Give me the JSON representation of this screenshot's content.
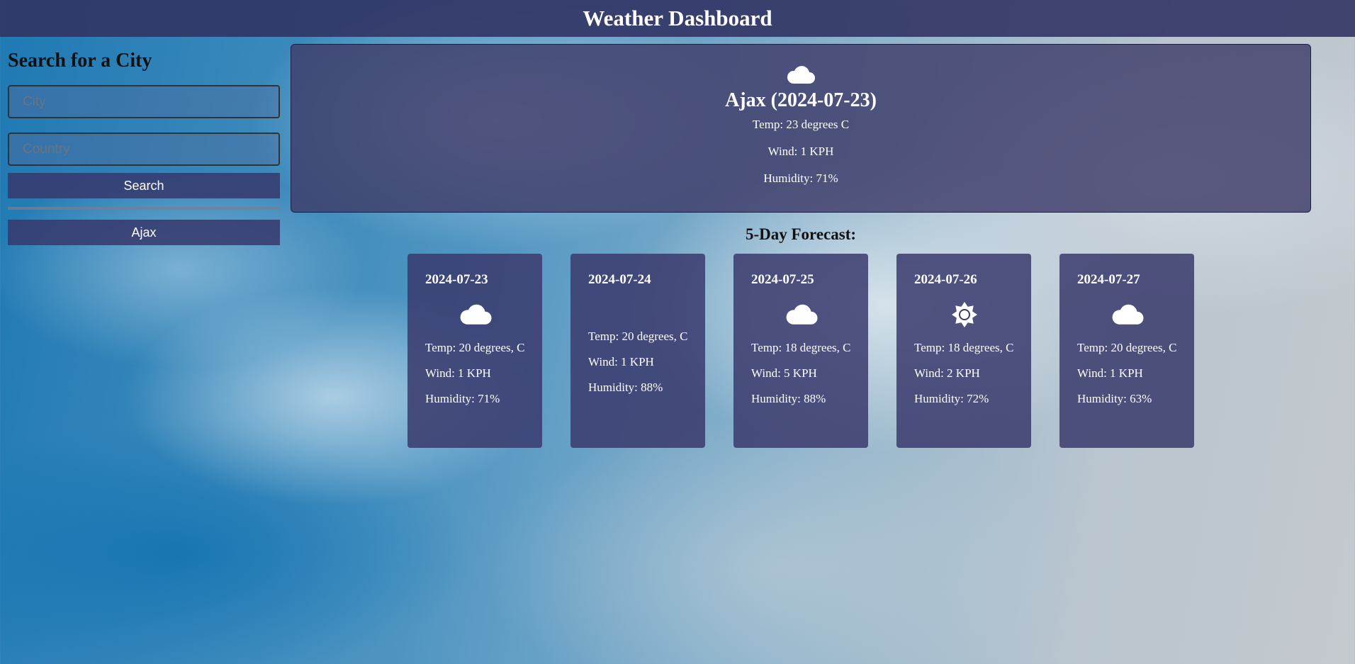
{
  "header": {
    "title": "Weather Dashboard"
  },
  "sidebar": {
    "heading": "Search for a City",
    "city_placeholder": "City",
    "country_placeholder": "Country",
    "search_label": "Search",
    "history": [
      {
        "label": "Ajax"
      }
    ]
  },
  "current": {
    "icon": "cloud-icon",
    "title": "Ajax (2024-07-23)",
    "temp": "Temp: 23 degrees C",
    "wind": "Wind: 1 KPH",
    "humidity": "Humidity: 71%"
  },
  "forecast": {
    "title": "5-Day Forecast:",
    "days": [
      {
        "date": "2024-07-23",
        "icon": "cloud-icon",
        "temp": "Temp: 20 degrees, C",
        "wind": "Wind: 1 KPH",
        "humidity": "Humidity: 71%"
      },
      {
        "date": "2024-07-24",
        "icon": "",
        "temp": "Temp: 20 degrees, C",
        "wind": "Wind: 1 KPH",
        "humidity": "Humidity: 88%"
      },
      {
        "date": "2024-07-25",
        "icon": "cloud-icon",
        "temp": "Temp: 18 degrees, C",
        "wind": "Wind: 5 KPH",
        "humidity": "Humidity: 88%"
      },
      {
        "date": "2024-07-26",
        "icon": "sun-icon",
        "temp": "Temp: 18 degrees, C",
        "wind": "Wind: 2 KPH",
        "humidity": "Humidity: 72%"
      },
      {
        "date": "2024-07-27",
        "icon": "cloud-icon",
        "temp": "Temp: 20 degrees, C",
        "wind": "Wind: 1 KPH",
        "humidity": "Humidity: 63%"
      }
    ]
  }
}
